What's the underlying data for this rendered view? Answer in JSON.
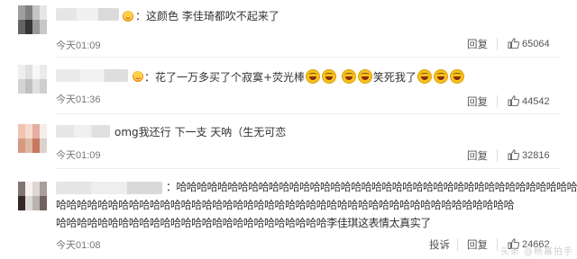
{
  "comments": [
    {
      "text": "：这颜色 李佳琦都吹不起来了",
      "time": "今天01:09",
      "reply_label": "回复",
      "likes": "65064",
      "avatar_colors": [
        "#6b6b6b",
        "#3b3b3b",
        "#a6a6a6",
        "#d8d8d8"
      ],
      "name_colors": [
        "#e3e3e3",
        "#eeeeee",
        "#d6d6d6"
      ]
    },
    {
      "text": "：花了一万多买了个寂寞+荧光棒",
      "text_after": "笑死我了",
      "time": "今天01:36",
      "reply_label": "回复",
      "likes": "44542",
      "avatar_colors": [
        "#e6e6e6",
        "#cfcfcf",
        "#f3f3f3",
        "#e0e0e0"
      ],
      "name_colors": [
        "#e7e7e7",
        "#f0f0f0",
        "#dadada"
      ]
    },
    {
      "text": "omg我还行 下一支 天呐（生无可恋",
      "time": "今天01:09",
      "reply_label": "回复",
      "likes": "32816",
      "avatar_colors": [
        "#e9a58c",
        "#f2c7b3",
        "#d9826a",
        "#efe3de"
      ],
      "name_colors": []
    },
    {
      "text_lines": [
        "：哈哈哈哈哈哈哈哈哈哈哈哈哈哈哈哈哈哈哈哈哈哈哈哈哈哈哈哈哈哈哈哈哈哈哈哈哈哈哈哈",
        "哈哈哈哈哈哈哈哈哈哈哈哈哈哈哈哈哈哈哈哈哈哈哈哈哈哈哈哈哈哈哈哈哈哈哈哈哈哈哈哈哈哈哈哈",
        "哈哈哈哈哈哈哈哈哈哈哈哈哈哈哈哈哈哈哈哈哈哈哈哈哈哈李佳琪这表情太真实了"
      ],
      "time": "今天01:08",
      "report_label": "投诉",
      "reply_label": "回复",
      "likes": "24662",
      "avatar_colors": [
        "#3a2a2a",
        "#f1ece8",
        "#c9c2bf",
        "#7b6a63"
      ],
      "name_colors": [
        "#e2e2e2",
        "#ececec",
        "#d5d5d5"
      ]
    }
  ],
  "watermark": "头条 @杨幂拍手"
}
